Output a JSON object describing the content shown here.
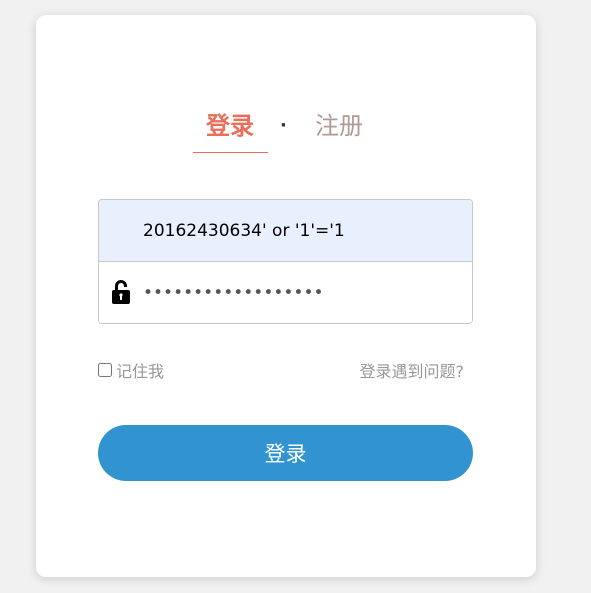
{
  "tabs": {
    "login": "登录",
    "separator": "·",
    "register": "注册"
  },
  "form": {
    "username_value": "20162430634' or '1'='1",
    "password_value": "••••••••••••••••••",
    "remember_label": "记住我",
    "remember_checked": false,
    "problem_link": "登录遇到问题?",
    "submit_label": "登录"
  },
  "colors": {
    "accent": "#ea6f5a",
    "button": "#3194d0",
    "autofill": "#e8f0fe"
  }
}
